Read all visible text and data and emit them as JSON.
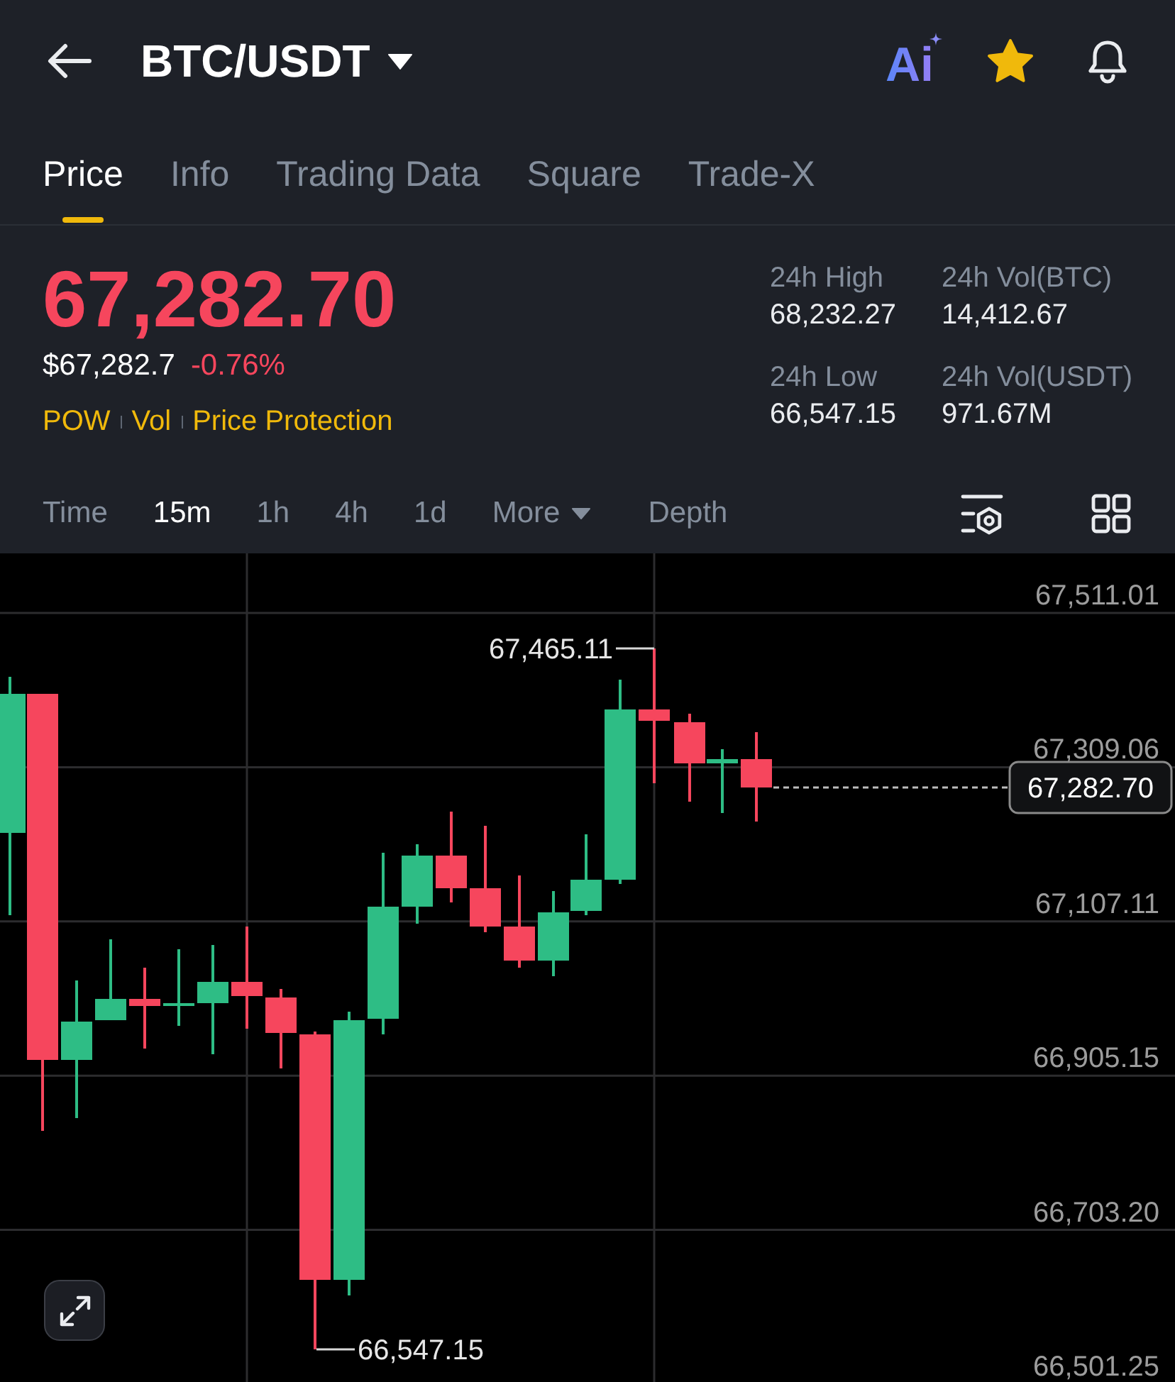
{
  "header": {
    "title": "BTC/USDT",
    "ai_label": "Ai",
    "favorite": true
  },
  "tabs": [
    {
      "label": "Price",
      "selected": true
    },
    {
      "label": "Info",
      "selected": false
    },
    {
      "label": "Trading Data",
      "selected": false
    },
    {
      "label": "Square",
      "selected": false
    },
    {
      "label": "Trade-X",
      "selected": false
    }
  ],
  "ticker": {
    "last_price": "67,282.70",
    "falling": true,
    "usd_value": "$67,282.7",
    "change": "-0.76%",
    "tags": [
      "POW",
      "Vol",
      "Price Protection"
    ],
    "stats": [
      {
        "label": "24h High",
        "value": "68,232.27"
      },
      {
        "label": "24h Vol(BTC)",
        "value": "14,412.67"
      },
      {
        "label": "24h Low",
        "value": "66,547.15"
      },
      {
        "label": "24h Vol(USDT)",
        "value": "971.67M"
      }
    ]
  },
  "intervals": [
    {
      "label": "Time",
      "kind": "option",
      "selected": false
    },
    {
      "label": "15m",
      "kind": "option",
      "selected": true
    },
    {
      "label": "1h",
      "kind": "option",
      "selected": false
    },
    {
      "label": "4h",
      "kind": "option",
      "selected": false
    },
    {
      "label": "1d",
      "kind": "option",
      "selected": false
    },
    {
      "label": "More",
      "kind": "menu",
      "selected": false
    },
    {
      "label": "Depth",
      "kind": "option",
      "selected": false
    }
  ],
  "chart": {
    "price_scale": [
      "67,511.01",
      "67,309.06",
      "67,107.11",
      "66,905.15",
      "66,703.20",
      "66,501.25"
    ],
    "high_marker": "67,465.11",
    "low_marker": "66,547.15",
    "last_price_tag": "67,282.70"
  }
}
